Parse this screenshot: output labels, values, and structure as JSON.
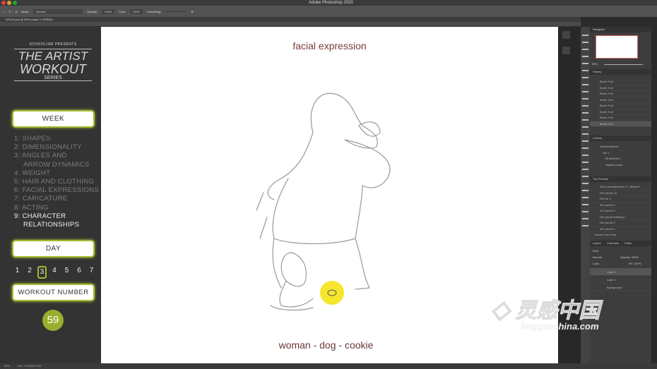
{
  "app": {
    "title": "Adobe Photoshop 2020",
    "doc_tab": "W9-D3.psd @ 59% (Layer 2, RGB/8) *",
    "zoom": "59%"
  },
  "options": {
    "mode_label": "Mode:",
    "mode": "Normal",
    "opacity_label": "Opacity:",
    "opacity": "100%",
    "flow_label": "Flow:",
    "flow": "100%",
    "smoothing_label": "Smoothing:"
  },
  "sidebar": {
    "presents": "SCHOOLISM PRESENTS",
    "logo_line1": "THE ARTIST",
    "logo_line2": "WORKOUT",
    "logo_line3": "SERIES",
    "week_label": "WEEK",
    "weeks": [
      "1:  SHAPES",
      "2: DIMENSIONALITY",
      "3: ANGLES AND",
      "ARROW DYNAMICS",
      "4: WEIGHT",
      "5: HAIR AND CLOTHING",
      "6: FACIAL EXPRESSIONS",
      "7: CARICATURE",
      "8: ACTING",
      "9: CHARACTER",
      "RELATIONSHIPS"
    ],
    "day_label": "DAY",
    "days": [
      "1",
      "2",
      "3",
      "4",
      "5",
      "6",
      "7"
    ],
    "selected_day": "3",
    "workout_label": "WORKOUT NUMBER",
    "workout_number": "59",
    "accent": "#a8b832"
  },
  "canvas": {
    "top_caption": "facial expression",
    "bottom_caption": "woman - dog - cookie"
  },
  "panels": {
    "navigator": "Navigator",
    "history": "History",
    "history_items": [
      "Brush Tool",
      "Brush Tool",
      "Brush Tool",
      "Brush Tool",
      "Brush Tool",
      "Brush Tool",
      "Brush Tool",
      "Brush Tool"
    ],
    "actions": "Actions",
    "action_items": [
      "Default Actions",
      "Set 1",
      "fill selection",
      "clipping mask"
    ],
    "tool_presets": "Tool Presets",
    "preset_items": [
      "DKI a kneaderbrush 3 - 68 pixel",
      "DKI pencil 1a",
      "DKI 4b 3",
      "DKI pencil 4",
      "DKI pencil 5",
      "DKI pencil brhbany 1",
      "DKI pencil 2",
      "DKI pencil 4"
    ],
    "current_tool_only": "Current Tool Only",
    "layers_tabs": [
      "Layers",
      "Channels",
      "Paths"
    ],
    "kind": "Kind",
    "blend": "Normal",
    "opacity_label": "Opacity:",
    "opacity": "100%",
    "lock_label": "Lock:",
    "fill_label": "Fill:",
    "fill": "100%",
    "layers": [
      "Layer 2",
      "Layer 1",
      "Background"
    ]
  },
  "watermark": {
    "text": "灵感中国",
    "sub": "lingganchina.com"
  },
  "status": {
    "zoom": "59%",
    "doc": "Doc: 25.5M/42.5M"
  }
}
